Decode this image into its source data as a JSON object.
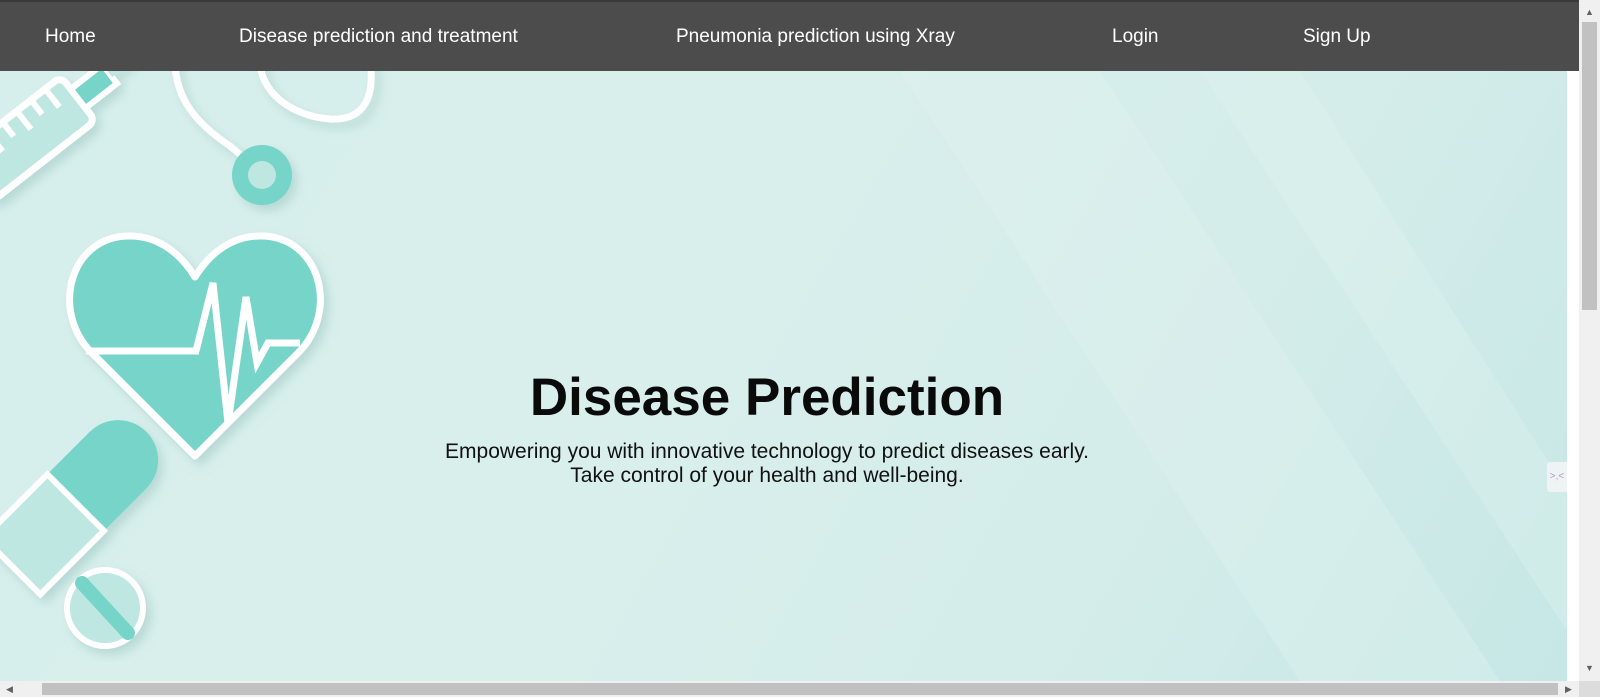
{
  "nav": {
    "items": [
      {
        "label": "Home"
      },
      {
        "label": "Disease prediction and treatment"
      },
      {
        "label": "Pneumonia prediction using Xray"
      },
      {
        "label": "Login"
      },
      {
        "label": "Sign Up"
      }
    ]
  },
  "hero": {
    "title": "Disease Prediction",
    "subtitle_line1": "Empowering you with innovative technology to predict diseases early.",
    "subtitle_line2": "Take control of your health and well-being."
  },
  "icons": {
    "background": [
      "syringe-icon",
      "stethoscope-icon",
      "heart-pulse-icon",
      "pill-capsule-icon",
      "pill-tablet-icon"
    ],
    "side_widget": "chat-widget-icon",
    "scroll_arrows": [
      "arrow-up-icon",
      "arrow-down-icon",
      "arrow-left-icon",
      "arrow-right-icon"
    ]
  },
  "colors": {
    "navbar": "#4c4c4c",
    "accent": "#77d4c8",
    "hero_background": "#d6efec"
  }
}
